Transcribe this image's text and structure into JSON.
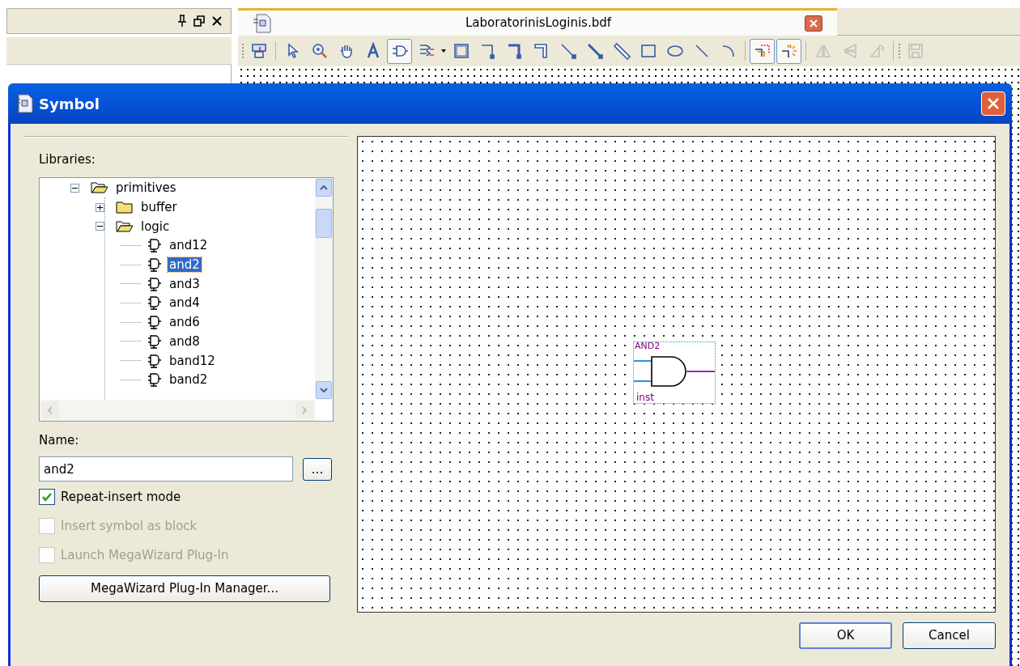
{
  "document_tab": {
    "title": "LaboratorinisLoginis.bdf"
  },
  "toolbar": {
    "groups": [
      [
        {
          "kind": "import",
          "selected": false,
          "disabled": false
        }
      ],
      [
        {
          "kind": "pointer",
          "selected": false,
          "disabled": false
        },
        {
          "kind": "zoom",
          "selected": false,
          "disabled": false
        },
        {
          "kind": "hand",
          "selected": false,
          "disabled": false
        },
        {
          "kind": "text",
          "selected": false,
          "disabled": false
        },
        {
          "kind": "gate",
          "selected": true,
          "disabled": false
        },
        {
          "kind": "pin",
          "selected": false,
          "disabled": false
        },
        {
          "kind": "block",
          "selected": false,
          "disabled": false
        },
        {
          "kind": "orthnode",
          "selected": false,
          "disabled": false
        },
        {
          "kind": "orthbus",
          "selected": false,
          "disabled": false
        },
        {
          "kind": "orthconduit",
          "selected": false,
          "disabled": false
        },
        {
          "kind": "diagnode",
          "selected": false,
          "disabled": false
        },
        {
          "kind": "diagbus",
          "selected": false,
          "disabled": false
        },
        {
          "kind": "diagconduit",
          "selected": false,
          "disabled": false
        },
        {
          "kind": "rectangle",
          "selected": false,
          "disabled": false
        },
        {
          "kind": "ellipse",
          "selected": false,
          "disabled": false
        },
        {
          "kind": "line",
          "selected": false,
          "disabled": false
        },
        {
          "kind": "arc",
          "selected": false,
          "disabled": false
        }
      ],
      [
        {
          "kind": "rubberband",
          "selected": true,
          "disabled": false
        },
        {
          "kind": "partial",
          "selected": true,
          "disabled": false
        }
      ],
      [
        {
          "kind": "fliph",
          "selected": false,
          "disabled": true
        },
        {
          "kind": "flipv",
          "selected": false,
          "disabled": true
        },
        {
          "kind": "rotate",
          "selected": false,
          "disabled": true
        }
      ],
      [
        {
          "kind": "save",
          "selected": false,
          "disabled": true
        }
      ]
    ]
  },
  "dialog": {
    "title": "Symbol",
    "libraries_label": "Libraries:",
    "tree": [
      {
        "label": "primitives",
        "expanded": true,
        "selected": false,
        "children": [
          {
            "label": "buffer",
            "expanded": false,
            "selected": false
          },
          {
            "label": "logic",
            "expanded": true,
            "selected": false,
            "children": [
              {
                "label": "and12",
                "selected": false
              },
              {
                "label": "and2",
                "selected": true
              },
              {
                "label": "and3",
                "selected": false
              },
              {
                "label": "and4",
                "selected": false
              },
              {
                "label": "and6",
                "selected": false
              },
              {
                "label": "and8",
                "selected": false
              },
              {
                "label": "band12",
                "selected": false
              },
              {
                "label": "band2",
                "selected": false
              }
            ]
          }
        ]
      }
    ],
    "name_label": "Name:",
    "name_value": "and2",
    "browse_button": "...",
    "options": [
      {
        "label": "Repeat-insert mode",
        "checked": true,
        "disabled": false
      },
      {
        "label": "Insert symbol as block",
        "checked": false,
        "disabled": true
      },
      {
        "label": "Launch MegaWizard Plug-In",
        "checked": false,
        "disabled": true
      }
    ],
    "wizard_button": "MegaWizard Plug-In Manager...",
    "preview": {
      "symbol_name": "AND2",
      "instance_name": "inst"
    },
    "buttons": [
      "OK",
      "Cancel"
    ]
  }
}
